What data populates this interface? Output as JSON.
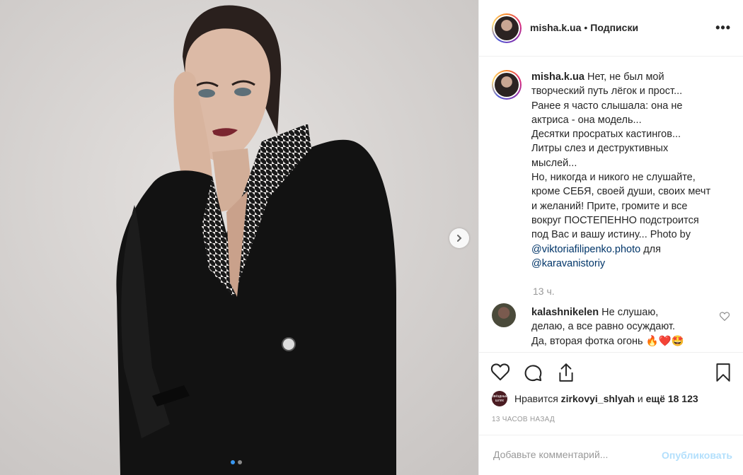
{
  "post": {
    "author": "misha.k.ua",
    "separator": "•",
    "follow_label": "Подписки",
    "more_label": "•••"
  },
  "caption": {
    "author": "misha.k.ua",
    "lines": [
      "Нет, не был мой",
      "творческий путь лёгок и прост...",
      "Ранее я часто слышала: она не",
      "актриса - она модель...",
      "Десятки просратых кастингов...",
      "Литры слез и деструктивных",
      "мыслей...",
      "Но, никогда и никого не слушайте,",
      "кроме СЕБЯ, своей души, своих мечт",
      "и желаний! Прите, громите и все",
      "вокруг ПОСТЕПЕННО подстроится",
      "под Вас и вашу истину... Photo by"
    ],
    "mention1": "@viktoriafilipenko.photo",
    "mention_suffix": "для",
    "mention2": "@karavanistoriy",
    "time": "13 ч."
  },
  "comment": {
    "author": "kalashnikelen",
    "line1": "Не слушаю,",
    "line2": "делаю, а все равно осуждают.",
    "line3": "Да, вторая фотка огонь 🔥❤️🤩"
  },
  "likes": {
    "avatar_text": "Звёздный шлях",
    "prefix": "Нравится",
    "user": "zirkovyi_shlyah",
    "conj": "и",
    "rest": "ещё 18 123"
  },
  "post_time": "13 часов назад",
  "add_comment": {
    "placeholder": "Добавьте комментарий...",
    "publish_label": "Опубликовать"
  },
  "carousel": {
    "slide_count": 2,
    "active_index": 0
  },
  "colors": {
    "accent": "#3897f0",
    "publish_disabled": "#b2dffc",
    "muted": "#999999"
  }
}
